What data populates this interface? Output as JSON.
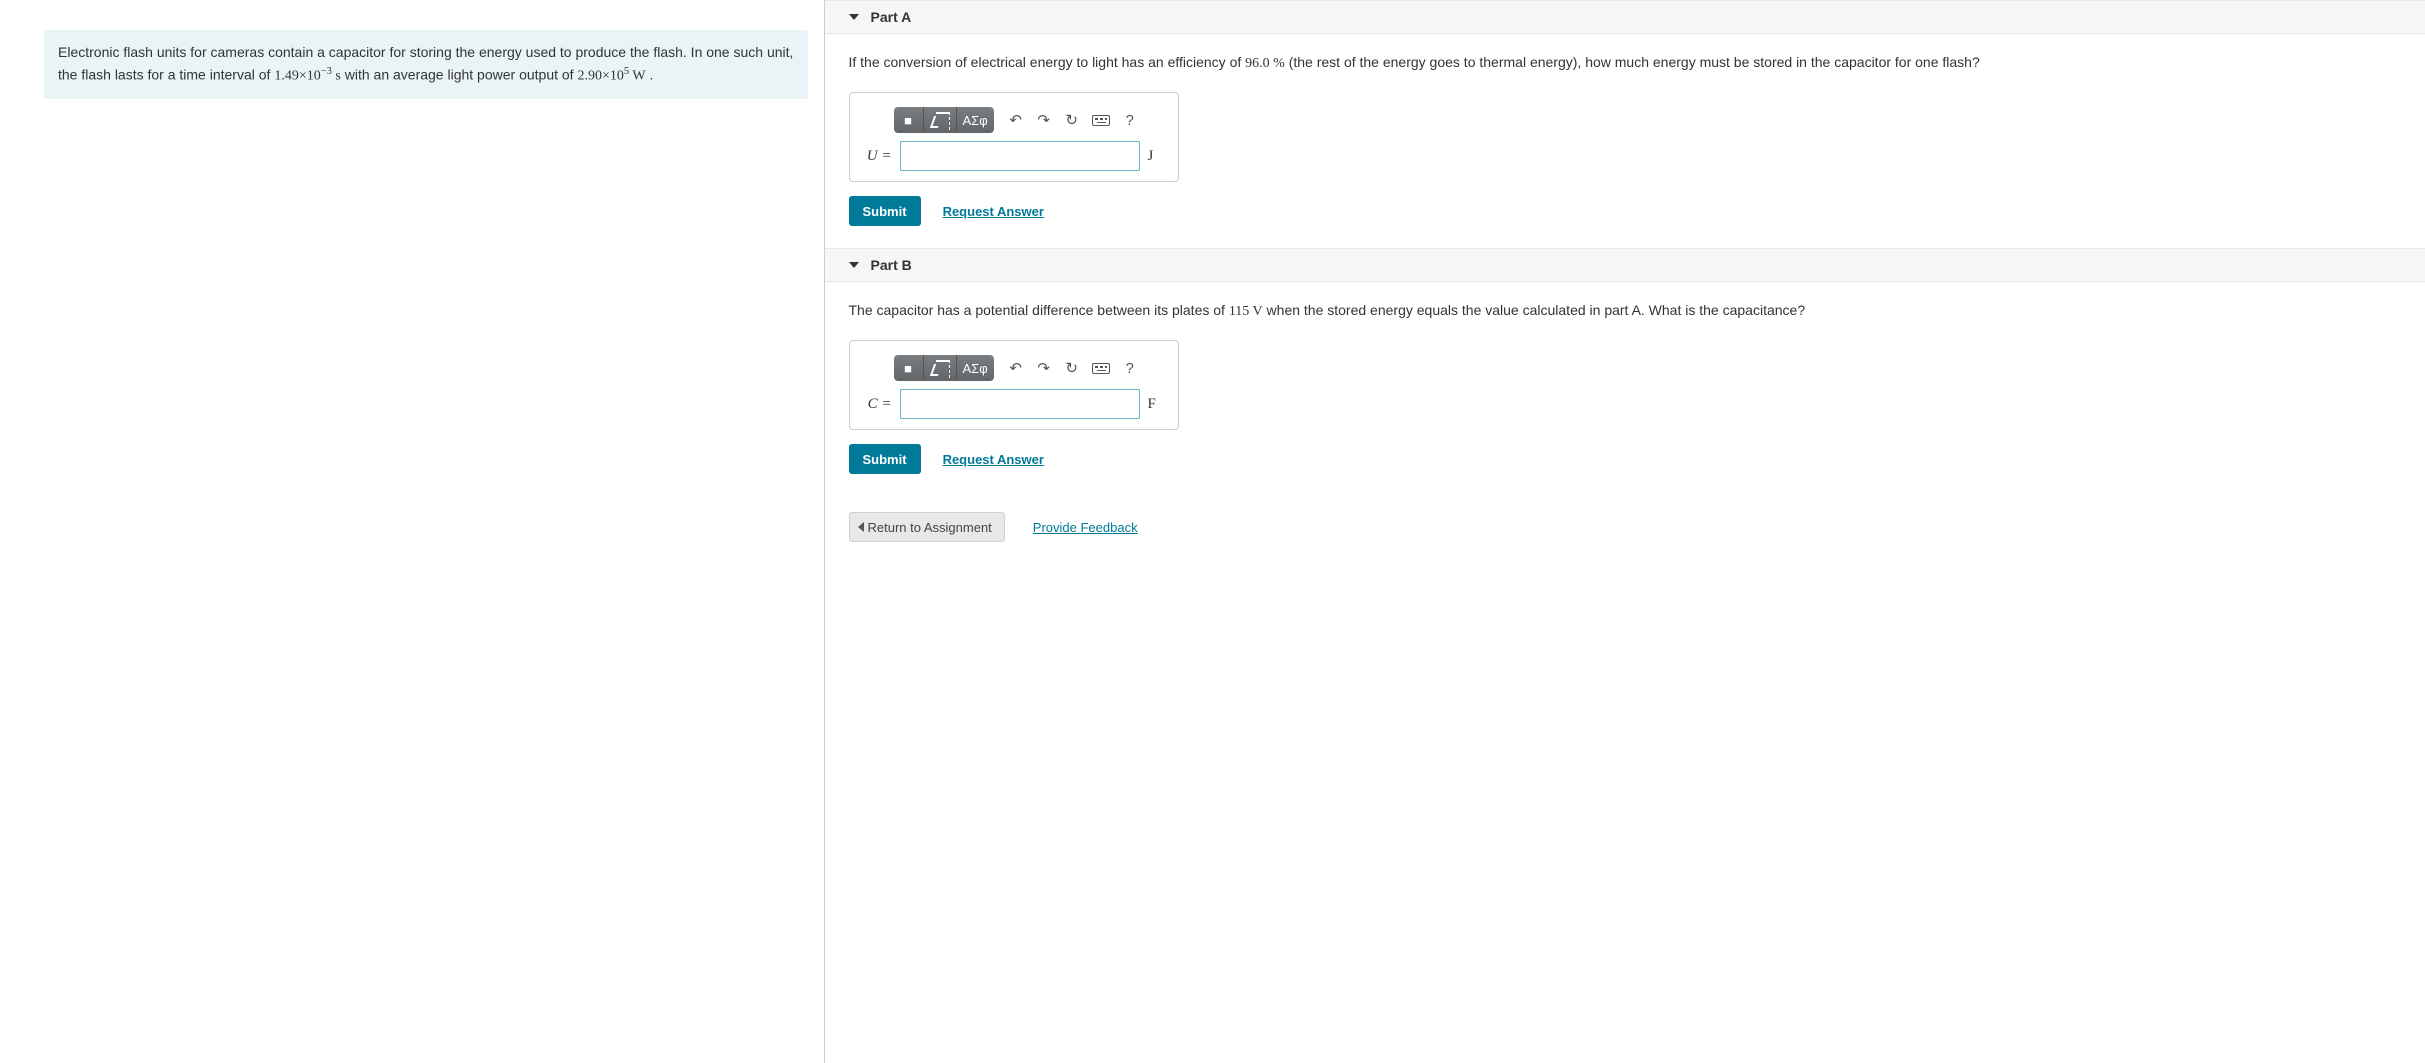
{
  "problem": {
    "text_prefix": "Electronic flash units for cameras contain a capacitor for storing the energy used to produce the flash. In one such unit, the flash lasts for a time interval of ",
    "time_value": "1.49×10",
    "time_exp": "−3",
    "time_unit": " s",
    "text_mid": " with an average light power output of ",
    "power_value": "2.90×10",
    "power_exp": "5",
    "power_unit": " W",
    "text_suffix": " ."
  },
  "toolbar": {
    "templates": "■",
    "root": "√",
    "greek": "ΑΣφ",
    "undo": "↶",
    "redo": "↷",
    "reset": "↻",
    "keyboard": "⌨",
    "help": "?"
  },
  "partA": {
    "title": "Part A",
    "q_prefix": "If the conversion of electrical energy to light has an efficiency of ",
    "eff_value": "96.0",
    "eff_unit": " %",
    "q_suffix": " (the rest of the energy goes to thermal energy), how much energy must be stored in the capacitor for one flash?",
    "var": "U",
    "eq": " =",
    "unit": "J",
    "value": ""
  },
  "partB": {
    "title": "Part B",
    "q_prefix": "The capacitor has a potential difference between its plates of ",
    "volt_value": "115",
    "volt_unit": " V",
    "q_suffix": " when the stored energy equals the value calculated in part A. What is the capacitance?",
    "var": "C",
    "eq": " =",
    "unit": "F",
    "value": ""
  },
  "actions": {
    "submit": "Submit",
    "request": "Request Answer",
    "return": "Return to Assignment",
    "feedback": "Provide Feedback"
  }
}
